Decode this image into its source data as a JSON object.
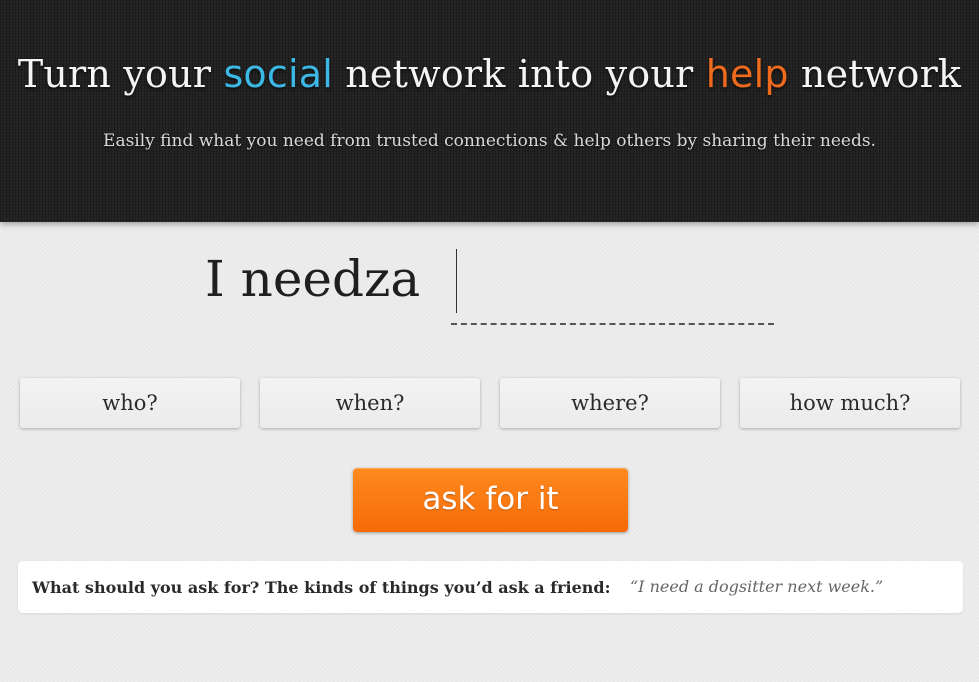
{
  "colors": {
    "social_accent": "#3cb8e6",
    "help_accent": "#ee6a1c",
    "button_orange": "#f77a12"
  },
  "hero": {
    "title_part1": "Turn your ",
    "title_social": "social",
    "title_part2": " network into your ",
    "title_help": "help",
    "title_part3": " network",
    "subtitle": "Easily find what you need from trusted connections & help others by sharing their needs."
  },
  "need": {
    "label": "I needza",
    "value": ""
  },
  "chips": {
    "who": "who?",
    "when": "when?",
    "where": "where?",
    "how_much": "how much?"
  },
  "ask_button": "ask for it",
  "tip": {
    "question": "What should you ask for? The kinds of things you’d ask a friend:",
    "example": "“I need a dogsitter next week.”"
  }
}
